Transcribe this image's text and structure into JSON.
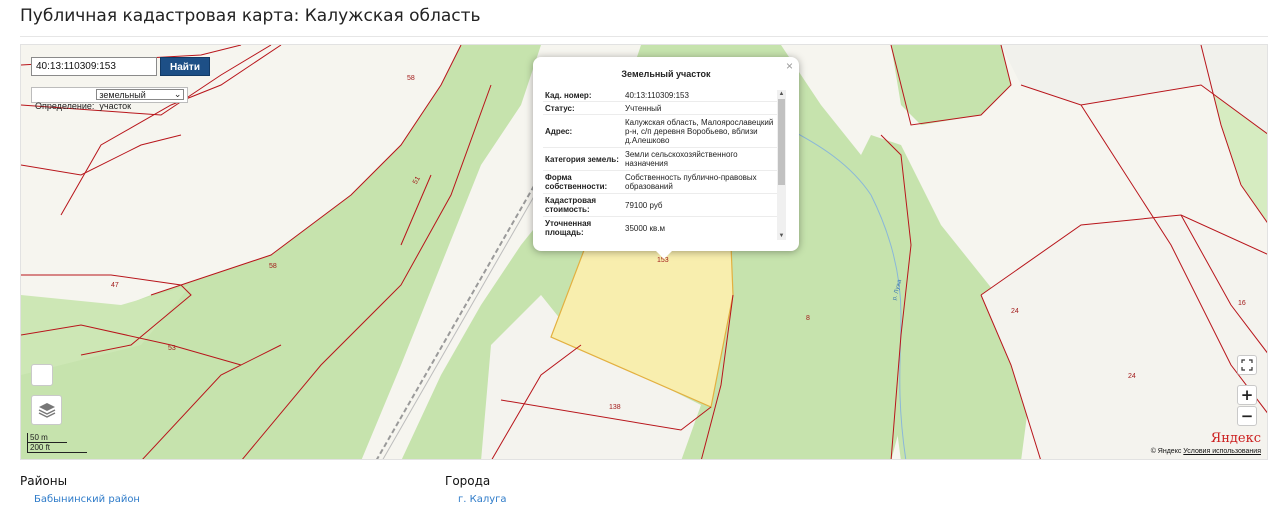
{
  "page": {
    "title": "Публичная кадастровая карта: Калужская область"
  },
  "search": {
    "value": "40:13:110309:153",
    "button_label": "Найти"
  },
  "definition": {
    "label": "Определение:",
    "selected": "земельный участок"
  },
  "popup": {
    "title": "Земельный участок",
    "close_glyph": "×",
    "rows": [
      {
        "key": "Кад. номер:",
        "value": "40:13:110309:153"
      },
      {
        "key": "Статус:",
        "value": "Учтенный"
      },
      {
        "key": "Адрес:",
        "value": "Калужская область, Малоярославецкий р-н, с/п деревня Воробьево, вблизи д.Алешково"
      },
      {
        "key": "Категория земель:",
        "value": "Земли сельскохозяйственного назначения"
      },
      {
        "key": "Форма собственности:",
        "value": "Собственность публично-правовых образований"
      },
      {
        "key": "Кадастровая стоимость:",
        "value": "79100 руб"
      },
      {
        "key": "Уточненная площадь:",
        "value": "35000 кв.м"
      }
    ]
  },
  "map": {
    "plot_numbers": [
      "58",
      "51",
      "58",
      "47",
      "53",
      "153",
      "138",
      "8",
      "24",
      "24",
      "16"
    ],
    "river_label": "р. Лужа",
    "scale": {
      "primary": "50 m",
      "secondary": "200 ft"
    },
    "provider": "Яндекс",
    "attribution": {
      "prefix": "© Яндекс",
      "link": "Условия использования"
    },
    "icons": [
      "fullscreen-icon",
      "zoom-in-icon",
      "zoom-out-icon",
      "layers-icon"
    ],
    "zoom_in_glyph": "+",
    "zoom_out_glyph": "−"
  },
  "footer": {
    "districts_heading": "Районы",
    "cities_heading": "Города",
    "districts_first": "Бабынинский район",
    "cities_first": "г. Калуга"
  }
}
